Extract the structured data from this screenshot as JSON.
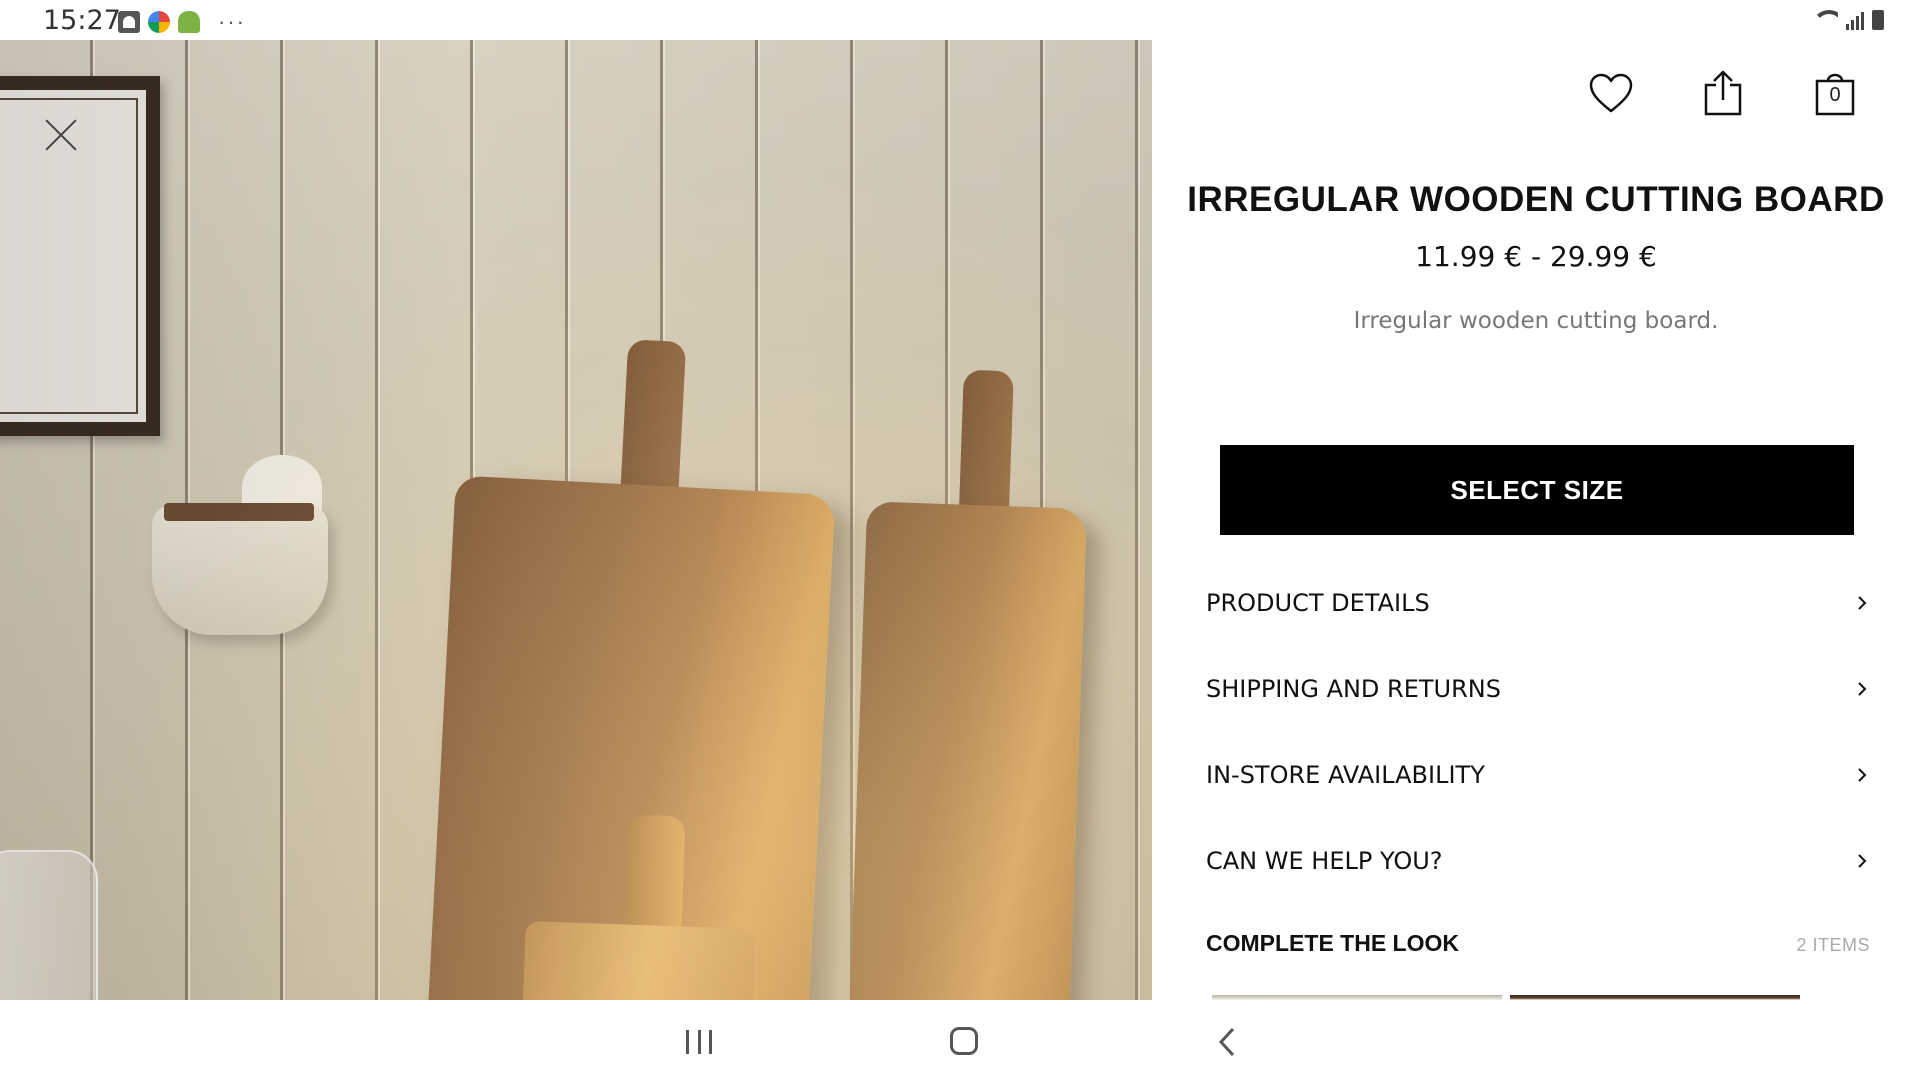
{
  "status_bar": {
    "time": "15:27",
    "left_icons": [
      "photo-notification-icon",
      "browser-icon",
      "android-icon",
      "more-notifications-icon"
    ],
    "right_icons": [
      "wifi-icon",
      "signal-icon",
      "battery-charging-icon"
    ]
  },
  "product": {
    "title": "IRREGULAR WOODEN CUTTING BOARD",
    "price": "11.99 € - 29.99 €",
    "description": "Irregular wooden cutting board.",
    "image": {
      "subject": "wooden cutting boards leaning on a wall"
    }
  },
  "actions": {
    "favorite_icon": "heart-icon",
    "share_icon": "share-icon",
    "bag_icon": "shopping-bag-icon",
    "bag_count": "0"
  },
  "select_size_label": "SELECT SIZE",
  "info_items": [
    {
      "label": "PRODUCT DETAILS"
    },
    {
      "label": "SHIPPING AND RETURNS"
    },
    {
      "label": "IN-STORE AVAILABILITY"
    },
    {
      "label": "CAN WE HELP YOU?"
    }
  ],
  "complete_the_look": {
    "title": "COMPLETE THE LOOK",
    "count": "2 ITEMS"
  },
  "nav_bar": {
    "icons": [
      "recent-apps-icon",
      "home-icon",
      "back-icon"
    ]
  },
  "colors": {
    "accent": "#000000",
    "text": "#111111",
    "muted": "#777777"
  }
}
